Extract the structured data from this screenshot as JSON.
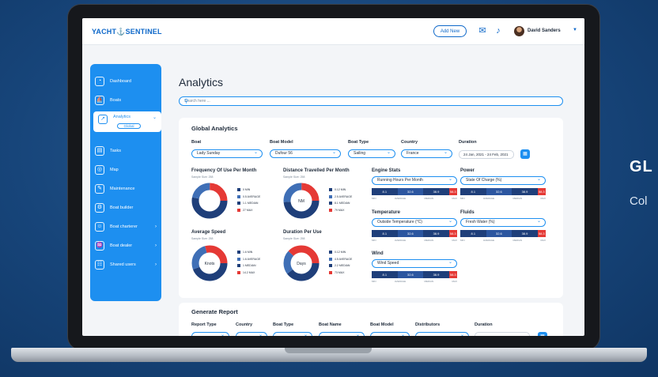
{
  "right_promo": {
    "title": "GL",
    "subtitle": "Col"
  },
  "topbar": {
    "logo": "YACHT⚓SENTINEL",
    "add_new": "Add New",
    "user_name": "David Sanders"
  },
  "sidebar": {
    "items": [
      {
        "label": "Dashboard",
        "icon": "speedometer-icon"
      },
      {
        "label": "Boats",
        "icon": "boat-icon"
      },
      {
        "label": "Analytics",
        "icon": "analytics-icon",
        "sub": "Global"
      },
      {
        "label": "Tasks",
        "icon": "clipboard-icon"
      },
      {
        "label": "Map",
        "icon": "globe-icon"
      },
      {
        "label": "Maintenance",
        "icon": "wrench-icon"
      },
      {
        "label": "Boat builder",
        "icon": "builder-icon"
      },
      {
        "label": "Boat charterer",
        "icon": "person-icon"
      },
      {
        "label": "Boat dealer",
        "icon": "handshake-icon"
      },
      {
        "label": "Shared users",
        "icon": "users-icon"
      }
    ]
  },
  "page": {
    "title": "Analytics",
    "search_placeholder": "Search here ..."
  },
  "global": {
    "title": "Global Analytics",
    "filters": {
      "boat_label": "Boat",
      "boat_value": "Lady Sunday",
      "model_label": "Boat Model",
      "model_value": "Dufour 56",
      "type_label": "Boat Type",
      "type_value": "Sailing",
      "country_label": "Country",
      "country_value": "France",
      "duration_label": "Duration",
      "duration_value": "24 Jan, 2021 - 24 Feb, 2021"
    },
    "charts": {
      "freq_title": "Frequency Of Use Per Month",
      "freq_sample": "Sample Size: 258",
      "dist_title": "Distance Travelled Per Month",
      "dist_sample": "Sample Size: 258",
      "speed_title": "Average Speed",
      "speed_sample": "Sample Size: 258",
      "dur_title": "Duration Per Use",
      "dur_sample": "Sample Size: 258",
      "speed_center": "Knots",
      "dist_center": "NM",
      "dur_center": "Days"
    },
    "stats": {
      "engine_title": "Engine Stats",
      "engine_value": "Running Hours Per Month",
      "power_title": "Power",
      "power_value": "State Of Charge (%)",
      "temp_title": "Temperature",
      "temp_value": "Outside Temperature (°C)",
      "fluids_title": "Fluids",
      "fluids_value": "Fresh Water (%)",
      "wind_title": "Wind",
      "wind_value": "Wind Speed"
    },
    "bar_values": [
      "8.1",
      "32.6",
      "38.9",
      "58.3"
    ],
    "bar_labels": [
      "MIN",
      "AVERAGE",
      "MEDIAN",
      "MAX"
    ]
  },
  "report": {
    "title": "Generate Report",
    "cols": [
      "Report Type",
      "Country",
      "Boat Type",
      "Boat Name",
      "Boat Model",
      "Distributors",
      "Duration"
    ]
  },
  "colors": {
    "primary": "#1d8ff0",
    "dark": "#1f3f7a",
    "red": "#e53935"
  }
}
